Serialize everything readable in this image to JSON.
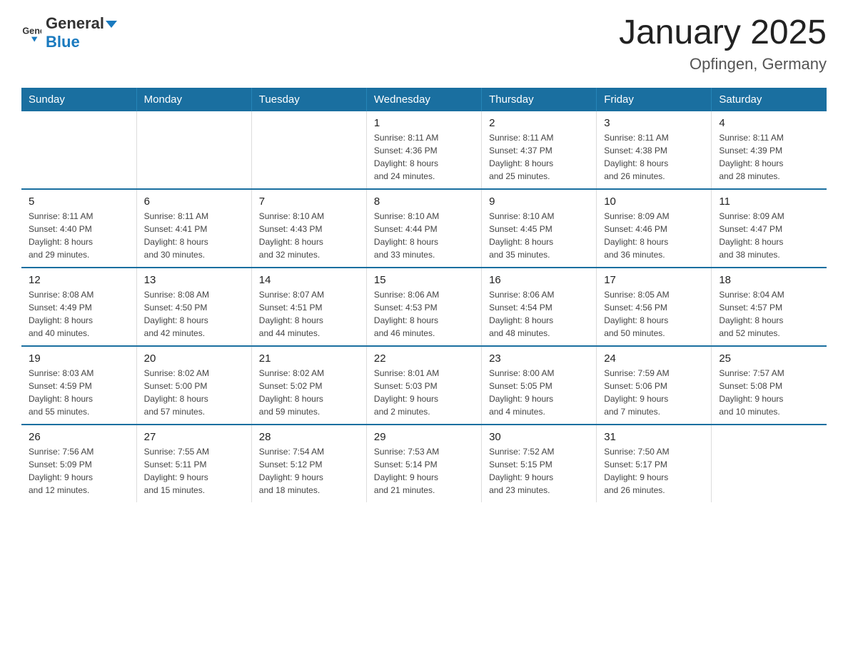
{
  "header": {
    "logo": {
      "text_general": "General",
      "text_blue": "Blue"
    },
    "title": "January 2025",
    "subtitle": "Opfingen, Germany"
  },
  "weekdays": [
    "Sunday",
    "Monday",
    "Tuesday",
    "Wednesday",
    "Thursday",
    "Friday",
    "Saturday"
  ],
  "weeks": [
    [
      {
        "day": "",
        "info": ""
      },
      {
        "day": "",
        "info": ""
      },
      {
        "day": "",
        "info": ""
      },
      {
        "day": "1",
        "info": "Sunrise: 8:11 AM\nSunset: 4:36 PM\nDaylight: 8 hours\nand 24 minutes."
      },
      {
        "day": "2",
        "info": "Sunrise: 8:11 AM\nSunset: 4:37 PM\nDaylight: 8 hours\nand 25 minutes."
      },
      {
        "day": "3",
        "info": "Sunrise: 8:11 AM\nSunset: 4:38 PM\nDaylight: 8 hours\nand 26 minutes."
      },
      {
        "day": "4",
        "info": "Sunrise: 8:11 AM\nSunset: 4:39 PM\nDaylight: 8 hours\nand 28 minutes."
      }
    ],
    [
      {
        "day": "5",
        "info": "Sunrise: 8:11 AM\nSunset: 4:40 PM\nDaylight: 8 hours\nand 29 minutes."
      },
      {
        "day": "6",
        "info": "Sunrise: 8:11 AM\nSunset: 4:41 PM\nDaylight: 8 hours\nand 30 minutes."
      },
      {
        "day": "7",
        "info": "Sunrise: 8:10 AM\nSunset: 4:43 PM\nDaylight: 8 hours\nand 32 minutes."
      },
      {
        "day": "8",
        "info": "Sunrise: 8:10 AM\nSunset: 4:44 PM\nDaylight: 8 hours\nand 33 minutes."
      },
      {
        "day": "9",
        "info": "Sunrise: 8:10 AM\nSunset: 4:45 PM\nDaylight: 8 hours\nand 35 minutes."
      },
      {
        "day": "10",
        "info": "Sunrise: 8:09 AM\nSunset: 4:46 PM\nDaylight: 8 hours\nand 36 minutes."
      },
      {
        "day": "11",
        "info": "Sunrise: 8:09 AM\nSunset: 4:47 PM\nDaylight: 8 hours\nand 38 minutes."
      }
    ],
    [
      {
        "day": "12",
        "info": "Sunrise: 8:08 AM\nSunset: 4:49 PM\nDaylight: 8 hours\nand 40 minutes."
      },
      {
        "day": "13",
        "info": "Sunrise: 8:08 AM\nSunset: 4:50 PM\nDaylight: 8 hours\nand 42 minutes."
      },
      {
        "day": "14",
        "info": "Sunrise: 8:07 AM\nSunset: 4:51 PM\nDaylight: 8 hours\nand 44 minutes."
      },
      {
        "day": "15",
        "info": "Sunrise: 8:06 AM\nSunset: 4:53 PM\nDaylight: 8 hours\nand 46 minutes."
      },
      {
        "day": "16",
        "info": "Sunrise: 8:06 AM\nSunset: 4:54 PM\nDaylight: 8 hours\nand 48 minutes."
      },
      {
        "day": "17",
        "info": "Sunrise: 8:05 AM\nSunset: 4:56 PM\nDaylight: 8 hours\nand 50 minutes."
      },
      {
        "day": "18",
        "info": "Sunrise: 8:04 AM\nSunset: 4:57 PM\nDaylight: 8 hours\nand 52 minutes."
      }
    ],
    [
      {
        "day": "19",
        "info": "Sunrise: 8:03 AM\nSunset: 4:59 PM\nDaylight: 8 hours\nand 55 minutes."
      },
      {
        "day": "20",
        "info": "Sunrise: 8:02 AM\nSunset: 5:00 PM\nDaylight: 8 hours\nand 57 minutes."
      },
      {
        "day": "21",
        "info": "Sunrise: 8:02 AM\nSunset: 5:02 PM\nDaylight: 8 hours\nand 59 minutes."
      },
      {
        "day": "22",
        "info": "Sunrise: 8:01 AM\nSunset: 5:03 PM\nDaylight: 9 hours\nand 2 minutes."
      },
      {
        "day": "23",
        "info": "Sunrise: 8:00 AM\nSunset: 5:05 PM\nDaylight: 9 hours\nand 4 minutes."
      },
      {
        "day": "24",
        "info": "Sunrise: 7:59 AM\nSunset: 5:06 PM\nDaylight: 9 hours\nand 7 minutes."
      },
      {
        "day": "25",
        "info": "Sunrise: 7:57 AM\nSunset: 5:08 PM\nDaylight: 9 hours\nand 10 minutes."
      }
    ],
    [
      {
        "day": "26",
        "info": "Sunrise: 7:56 AM\nSunset: 5:09 PM\nDaylight: 9 hours\nand 12 minutes."
      },
      {
        "day": "27",
        "info": "Sunrise: 7:55 AM\nSunset: 5:11 PM\nDaylight: 9 hours\nand 15 minutes."
      },
      {
        "day": "28",
        "info": "Sunrise: 7:54 AM\nSunset: 5:12 PM\nDaylight: 9 hours\nand 18 minutes."
      },
      {
        "day": "29",
        "info": "Sunrise: 7:53 AM\nSunset: 5:14 PM\nDaylight: 9 hours\nand 21 minutes."
      },
      {
        "day": "30",
        "info": "Sunrise: 7:52 AM\nSunset: 5:15 PM\nDaylight: 9 hours\nand 23 minutes."
      },
      {
        "day": "31",
        "info": "Sunrise: 7:50 AM\nSunset: 5:17 PM\nDaylight: 9 hours\nand 26 minutes."
      },
      {
        "day": "",
        "info": ""
      }
    ]
  ]
}
